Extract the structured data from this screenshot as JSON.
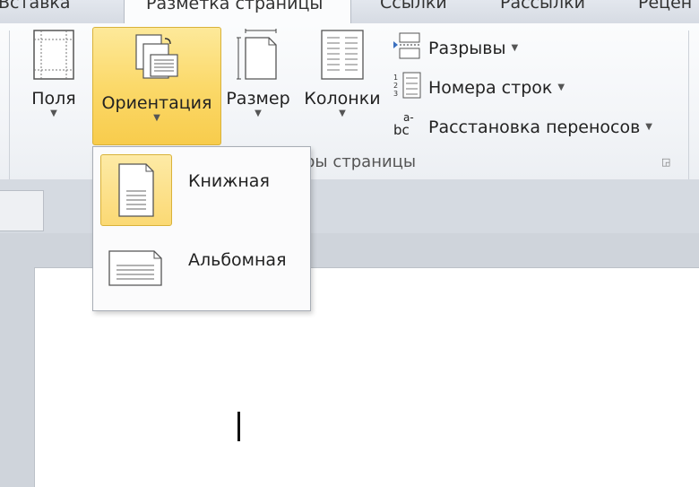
{
  "tabs": [
    {
      "label": "Вставка"
    },
    {
      "label": "Разметка страницы"
    },
    {
      "label": "Ссылки"
    },
    {
      "label": "Рассылки"
    },
    {
      "label": "Рецен"
    }
  ],
  "ribbon": {
    "margins_label": "Поля",
    "orientation_label": "Ориентация",
    "size_label": "Размер",
    "columns_label": "Колонки",
    "breaks_label": "Разрывы",
    "line_numbers_label": "Номера строк",
    "hyphenation_label": "Расстановка переносов",
    "group_label": "ры страницы"
  },
  "orientation_menu": {
    "items": [
      {
        "label": "Книжная",
        "selected": true
      },
      {
        "label": "Альбомная",
        "selected": false
      }
    ]
  },
  "colors": {
    "highlight": "#fbd96a",
    "highlight_border": "#d9b23a"
  }
}
